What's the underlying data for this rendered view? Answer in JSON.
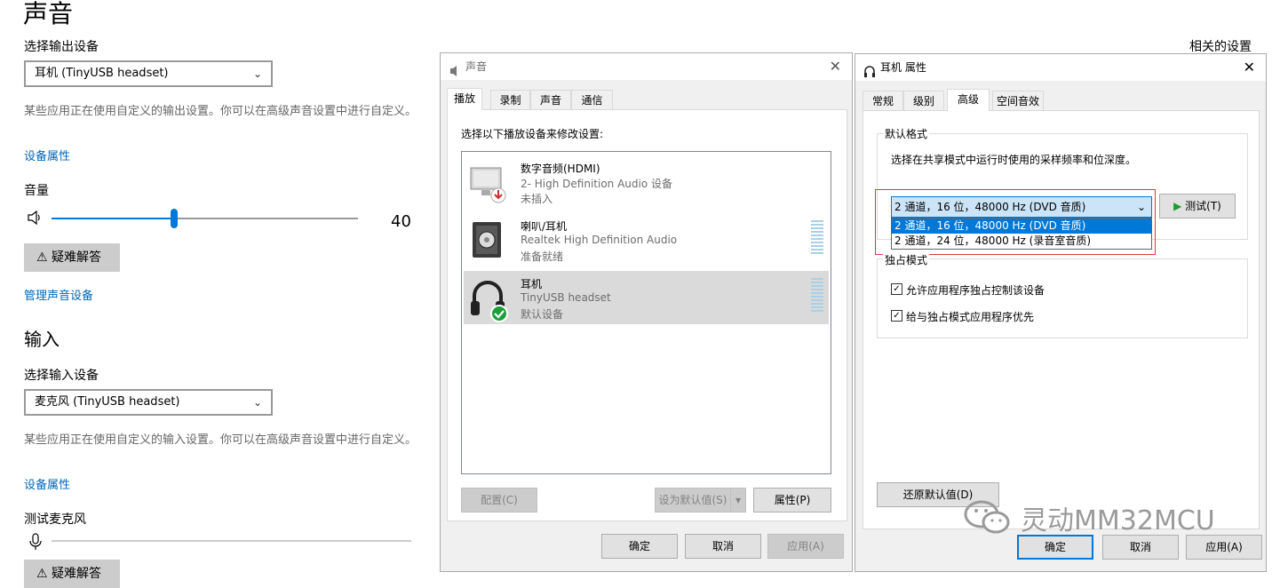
{
  "settings": {
    "title": "声音",
    "output": {
      "label": "选择输出设备",
      "device": "耳机 (TinyUSB headset)",
      "desc": "某些应用正在使用自定义的输出设置。你可以在高级声音设置中进行自定义。",
      "props_link": "设备属性",
      "volume_label": "音量",
      "volume_value": "40",
      "volume_fraction": 0.4,
      "troubleshoot": "疑难解答",
      "manage_link": "管理声音设备"
    },
    "input": {
      "heading": "输入",
      "label": "选择输入设备",
      "device": "麦克风 (TinyUSB headset)",
      "desc": "某些应用正在使用自定义的输入设置。你可以在高级声音设置中进行自定义。",
      "props_link": "设备属性",
      "test_label": "测试麦克风",
      "troubleshoot": "疑难解答"
    },
    "related": "相关的设置"
  },
  "sound_dialog": {
    "title": "声音",
    "tabs": [
      "播放",
      "录制",
      "声音",
      "通信"
    ],
    "instruction": "选择以下播放设备来修改设置:",
    "devices": [
      {
        "name": "数字音频(HDMI)",
        "driver": "2- High Definition Audio 设备",
        "status": "未插入"
      },
      {
        "name": "喇叭/耳机",
        "driver": "Realtek High Definition Audio",
        "status": "准备就绪"
      },
      {
        "name": "耳机",
        "driver": "TinyUSB headset",
        "status": "默认设备"
      }
    ],
    "buttons": {
      "configure": "配置(C)",
      "set_default": "设为默认值(S)",
      "properties": "属性(P)",
      "ok": "确定",
      "cancel": "取消",
      "apply": "应用(A)"
    }
  },
  "props_dialog": {
    "title": "耳机 属性",
    "tabs": [
      "常规",
      "级别",
      "高级",
      "空间音效"
    ],
    "default_format": {
      "legend": "默认格式",
      "desc": "选择在共享模式中运行时使用的采样频率和位深度。",
      "selected": "2 通道，16 位，48000 Hz (DVD 音质)",
      "options": [
        "2 通道，16 位，48000 Hz (DVD 音质)",
        "2 通道，24 位，48000 Hz (录音室音质)"
      ],
      "test": "测试(T)"
    },
    "exclusive": {
      "legend": "独占模式",
      "allow": "允许应用程序独占控制该设备",
      "priority": "给与独占模式应用程序优先"
    },
    "buttons": {
      "restore": "还原默认值(D)",
      "ok": "确定",
      "cancel": "取消",
      "apply": "应用(A)"
    },
    "watermark": "灵动MM32MCU"
  },
  "colors": {
    "accent": "#0078d7",
    "link": "#0067b8",
    "highlight_box": "#e0393e",
    "selection": "#0078d7"
  }
}
